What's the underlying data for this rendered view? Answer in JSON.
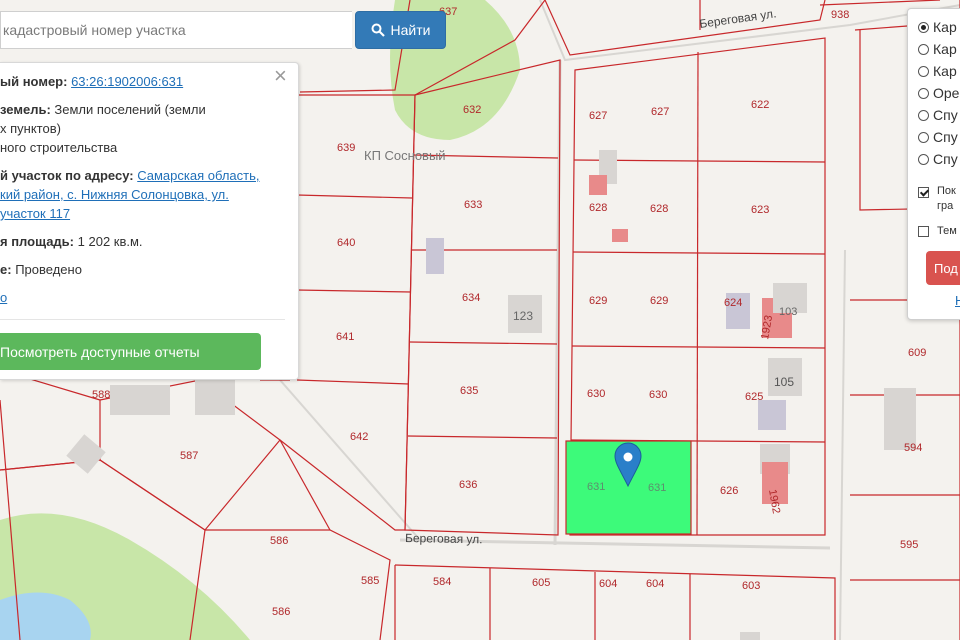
{
  "search": {
    "placeholder": "кадастровый номер участка",
    "button_label": "Найти"
  },
  "info": {
    "row1_label": "ый номер:",
    "row1_value": "63:26:1902006:631",
    "row2_label": "земель:",
    "row2_value": "Земли поселений (земли",
    "row2_line2": "х пунктов)",
    "row2_line3": "ного строительства",
    "row3_label": "й участок по адресу:",
    "row3_line1": "Самарская область,",
    "row3_line2": "кий район, с. Нижняя Солонцовка, ул.",
    "row3_line3": "участок 117",
    "row4_label": "я площадь:",
    "row4_value": "1 202 кв.м.",
    "row5_label": "е:",
    "row5_value": "Проведено",
    "row6_link": "о",
    "reports_button": "Посмотреть доступные отчеты"
  },
  "layers": {
    "radio_items": [
      "Кар",
      "Кар",
      "Кар",
      "Оре",
      "Спу",
      "Спу",
      "Спу"
    ],
    "checkbox1_line1": "Пок",
    "checkbox1_line2": "гра",
    "checkbox2": "Тем",
    "button_label": "Под",
    "link": "Н"
  },
  "map": {
    "settlement_label": "КП Сосновый",
    "street_top": "Береговая ул.",
    "street_bottom": "Береговая ул.",
    "plots": [
      "637",
      "938",
      "632",
      "627",
      "627",
      "622",
      "639",
      "633",
      "628",
      "628",
      "623",
      "640",
      "634",
      "123",
      "629",
      "629",
      "624",
      "103",
      "1923",
      "641",
      "635",
      "630",
      "630",
      "625",
      "105",
      "588",
      "642",
      "587",
      "636",
      "631",
      "631",
      "626",
      "1962",
      "594",
      "609",
      "586",
      "595",
      "585",
      "584",
      "605",
      "604",
      "604",
      "603",
      "586"
    ],
    "colors": {
      "selected_plot": "#3dfa7a",
      "plot_border": "#c8282b",
      "forest": "#c8e6a8",
      "water": "#a8d4f0",
      "marker": "#2a7fc9",
      "background": "#f4f2ee"
    }
  }
}
